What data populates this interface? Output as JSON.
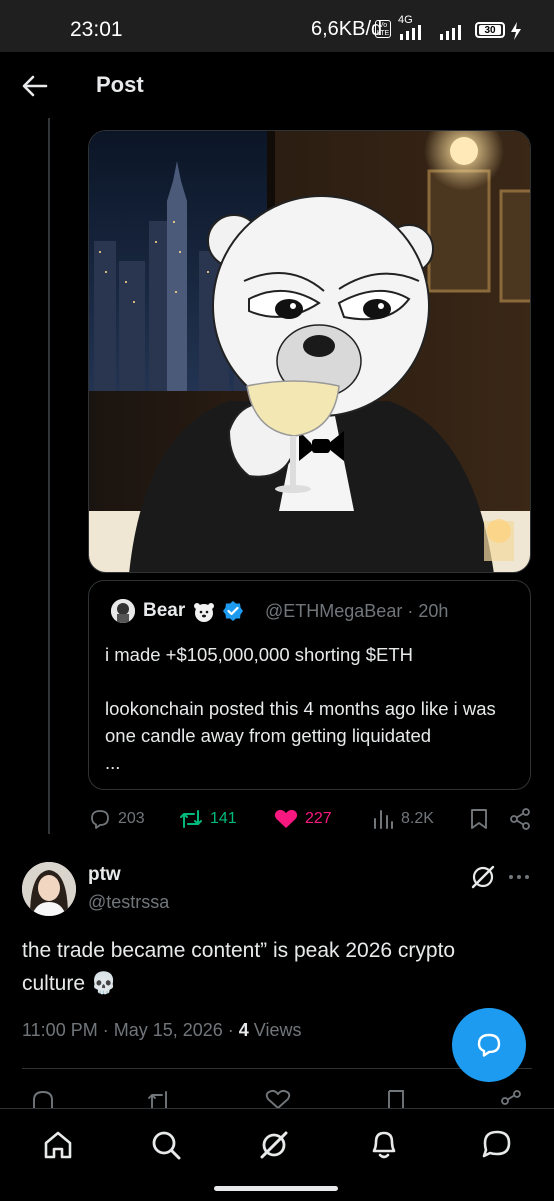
{
  "status_bar": {
    "time": "23:01",
    "network_rate": "6,6KB/d",
    "volte_label": "Vo LTE",
    "network_type": "4G",
    "battery_level": "30"
  },
  "header": {
    "title": "Post"
  },
  "quoted_post": {
    "name": "Bear",
    "handle_time": "@ETHMegaBear · 20h",
    "lines": [
      "i made +$105,000,000 shorting $ETH",
      "",
      "lookonchain posted this 4 months ago like i was one candle away from getting liquidated",
      "..."
    ]
  },
  "post_actions": {
    "replies": "203",
    "reposts": "141",
    "likes": "227",
    "views": "8.2K"
  },
  "reply": {
    "name": "ptw",
    "handle": "@testrssa",
    "text": "the trade became content” is peak 2026 crypto culture 💀",
    "time": "11:00 PM · May 15, 2026 · ",
    "views_count": "4",
    "views_label": " Views"
  },
  "colors": {
    "accent": "#1d9bf0",
    "like": "#f91880",
    "repost": "#00ba7c",
    "muted": "#71767b"
  },
  "icons": [
    "back-arrow-icon",
    "reply-icon",
    "repost-icon",
    "heart-icon",
    "views-icon",
    "bookmark-icon",
    "share-icon",
    "grok-icon",
    "more-icon",
    "home-icon",
    "search-icon",
    "bell-icon",
    "message-icon"
  ]
}
